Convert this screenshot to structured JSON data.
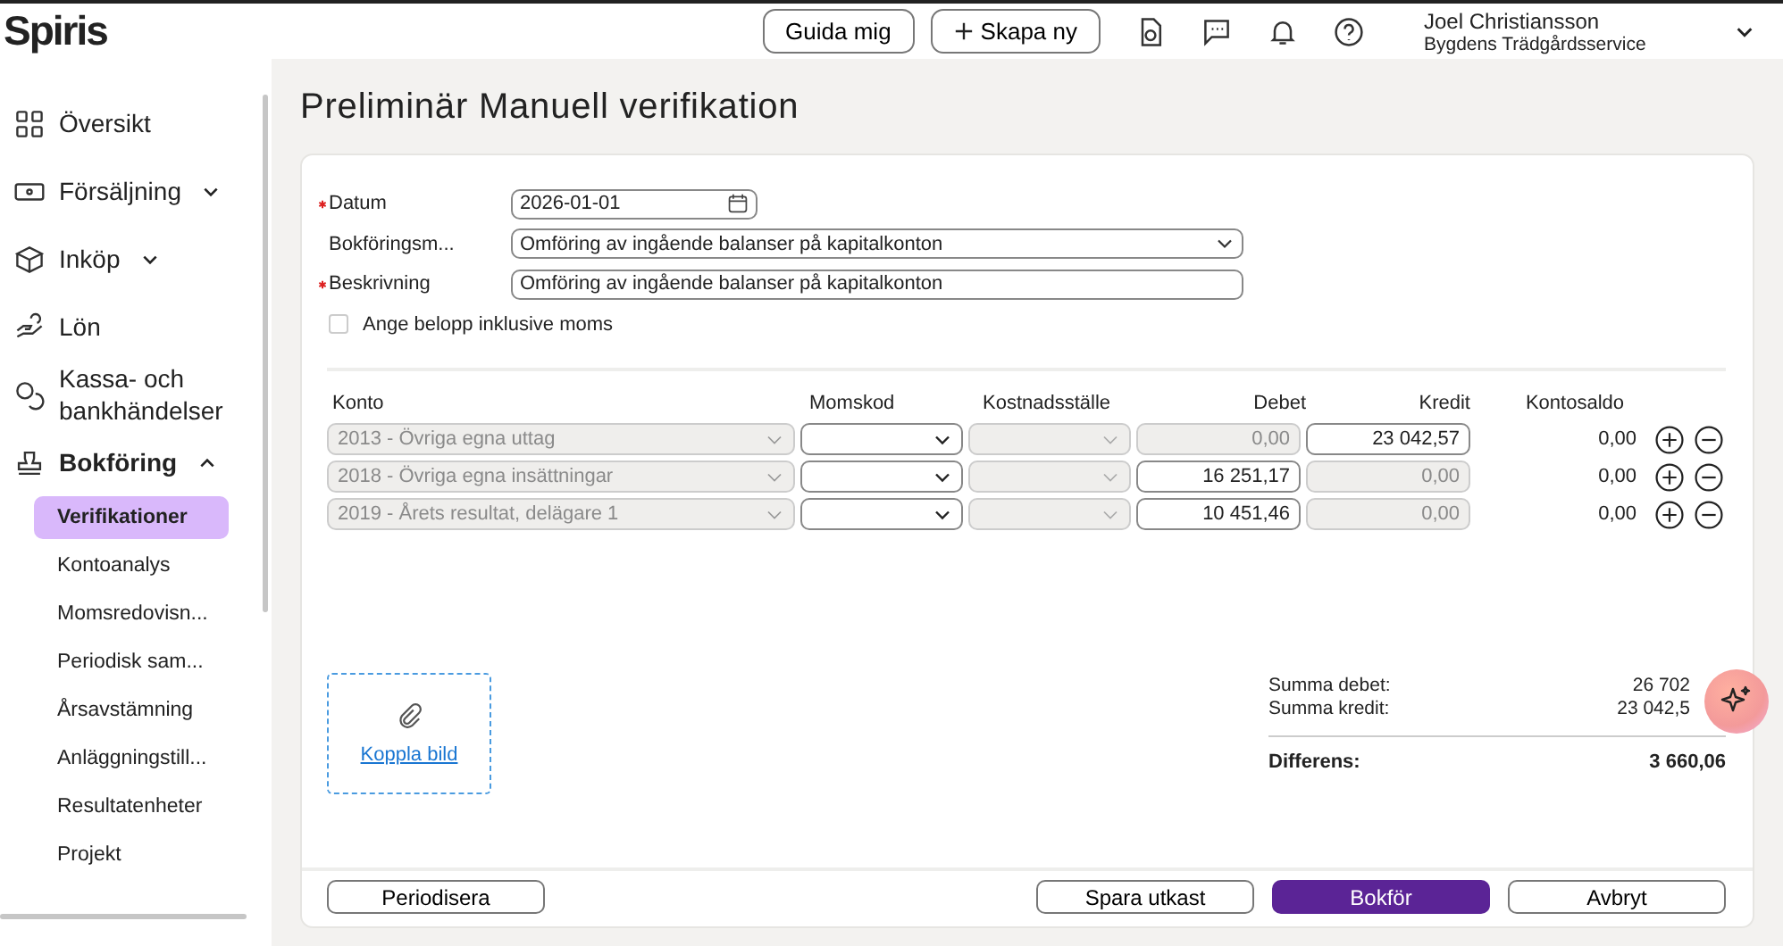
{
  "header": {
    "logo": "Spiris",
    "buttons": [
      {
        "label": "Guida mig",
        "kind": "plain"
      },
      {
        "label": "Skapa ny",
        "kind": "add"
      }
    ],
    "user": {
      "name": "Joel Christiansson",
      "company": "Bygdens Trädgårdsservice"
    }
  },
  "sidebar": {
    "items": [
      {
        "label": "Översikt"
      },
      {
        "label": "Försäljning",
        "expanded": false
      },
      {
        "label": "Inköp",
        "expanded": false
      },
      {
        "label": "Lön"
      },
      {
        "label": "Kassa- och bankhändelser"
      },
      {
        "label": "Bokföring",
        "expanded": true,
        "children": [
          {
            "label": "Verifikationer",
            "selected": true
          },
          {
            "label": "Kontoanalys",
            "selected": false
          },
          {
            "label": "Momsredovisn...",
            "selected": false
          },
          {
            "label": "Periodisk sam...",
            "selected": false
          },
          {
            "label": "Årsavstämning",
            "selected": false
          },
          {
            "label": "Anläggningstill...",
            "selected": false
          },
          {
            "label": "Resultatenheter",
            "selected": false
          },
          {
            "label": "Projekt",
            "selected": false
          }
        ]
      }
    ]
  },
  "page_title": "Preliminär Manuell verifikation",
  "form": {
    "fields": [
      {
        "label": "Datum",
        "required": true,
        "kind": "date",
        "value": "2026-01-01"
      },
      {
        "label": "Bokföringsm...",
        "required": false,
        "kind": "select",
        "value": "Omföring av ingående balanser på kapitalkonton"
      },
      {
        "label": "Beskrivning",
        "required": true,
        "kind": "text",
        "value": "Omföring av ingående balanser på kapitalkonton"
      }
    ],
    "checkbox": {
      "label": "Ange belopp inklusive moms",
      "checked": false
    }
  },
  "table": {
    "columns": [
      "Konto",
      "Momskod",
      "Kostnadsställe",
      "Debet",
      "Kredit",
      "Kontosaldo"
    ],
    "rows": [
      {
        "konto": "2013 - Övriga egna uttag",
        "debet": "0,00",
        "debet_disabled": true,
        "kredit": "23 042,57",
        "kredit_disabled": false,
        "kontosaldo": "0,00"
      },
      {
        "konto": "2018 - Övriga egna insättningar",
        "debet": "16 251,17",
        "debet_disabled": false,
        "kredit": "0,00",
        "kredit_disabled": true,
        "kontosaldo": "0,00"
      },
      {
        "konto": "2019 - Årets resultat, delägare 1",
        "debet": "10 451,46",
        "debet_disabled": false,
        "kredit": "0,00",
        "kredit_disabled": true,
        "kontosaldo": "0,00"
      }
    ]
  },
  "attachment": {
    "link": "Koppla bild"
  },
  "totals": [
    {
      "label": "Summa debet:",
      "value": "26 702"
    },
    {
      "label": "Summa kredit:",
      "value": "23 042,5"
    }
  ],
  "difference": {
    "label": "Differens:",
    "value": "3 660,06"
  },
  "footer": {
    "buttons": [
      {
        "label": "Periodisera",
        "kind": "secondary"
      },
      {
        "label": "Spara utkast",
        "kind": "secondary"
      },
      {
        "label": "Bokför",
        "kind": "primary"
      },
      {
        "label": "Avbryt",
        "kind": "secondary"
      }
    ]
  }
}
